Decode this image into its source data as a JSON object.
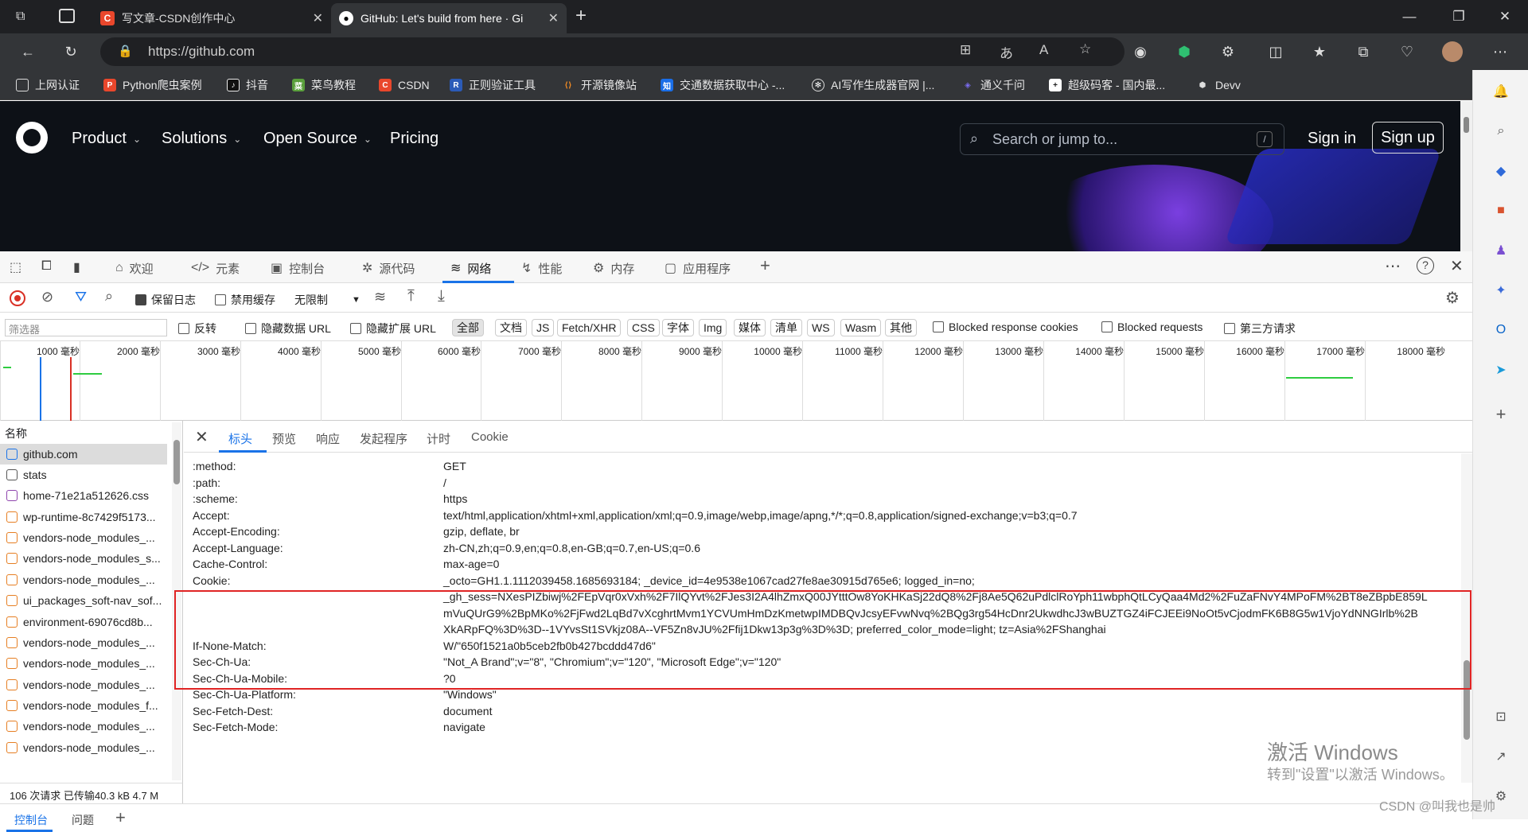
{
  "browser": {
    "tabs": [
      {
        "title": "写文章-CSDN创作中心",
        "icon": "csdn-icon"
      },
      {
        "title": "GitHub: Let's build from here · Gi",
        "icon": "github-icon"
      }
    ],
    "url": "https://github.com",
    "bookmarks": [
      "上网认证",
      "Python爬虫案例",
      "抖音",
      "菜鸟教程",
      "CSDN",
      "正则验证工具",
      "开源镜像站",
      "交通数据获取中心 -...",
      "AI写作生成器官网 |...",
      "通义千问",
      "超级码客 - 国内最...",
      "Devv"
    ]
  },
  "github": {
    "nav": [
      "Product",
      "Solutions",
      "Open Source",
      "Pricing"
    ],
    "search_placeholder": "Search or jump to...",
    "search_key": "/",
    "sign_in": "Sign in",
    "sign_up": "Sign up"
  },
  "devtools": {
    "tabs": [
      "欢迎",
      "元素",
      "控制台",
      "源代码",
      "网络",
      "性能",
      "内存",
      "应用程序"
    ],
    "preserve_log": "保留日志",
    "disable_cache": "禁用缓存",
    "throttle": "无限制",
    "filter_placeholder": "筛选器",
    "invert": "反转",
    "hide_data_url": "隐藏数据 URL",
    "hide_ext_url": "隐藏扩展 URL",
    "types": [
      "全部",
      "文档",
      "JS",
      "Fetch/XHR",
      "CSS",
      "字体",
      "Img",
      "媒体",
      "清单",
      "WS",
      "Wasm",
      "其他"
    ],
    "blocked_cookies": "Blocked response cookies",
    "blocked_requests": "Blocked requests",
    "third_party": "第三方请求",
    "ticks": [
      "1000 毫秒",
      "2000 毫秒",
      "3000 毫秒",
      "4000 毫秒",
      "5000 毫秒",
      "6000 毫秒",
      "7000 毫秒",
      "8000 毫秒",
      "9000 毫秒",
      "10000 毫秒",
      "11000 毫秒",
      "12000 毫秒",
      "13000 毫秒",
      "14000 毫秒",
      "15000 毫秒",
      "16000 毫秒",
      "17000 毫秒",
      "18000 毫秒"
    ],
    "name_header": "名称",
    "requests": [
      "github.com",
      "stats",
      "home-71e21a512626.css",
      "wp-runtime-8c7429f5173...",
      "vendors-node_modules_...",
      "vendors-node_modules_s...",
      "vendors-node_modules_...",
      "ui_packages_soft-nav_sof...",
      "environment-69076cd8b...",
      "vendors-node_modules_...",
      "vendors-node_modules_...",
      "vendors-node_modules_...",
      "vendors-node_modules_f...",
      "vendors-node_modules_...",
      "vendors-node_modules_..."
    ],
    "detail_tabs": [
      "标头",
      "预览",
      "响应",
      "发起程序",
      "计时",
      "Cookie"
    ],
    "headers": [
      {
        "k": ":method:",
        "v": "GET"
      },
      {
        "k": ":path:",
        "v": "/"
      },
      {
        "k": ":scheme:",
        "v": "https"
      },
      {
        "k": "Accept:",
        "v": "text/html,application/xhtml+xml,application/xml;q=0.9,image/webp,image/apng,*/*;q=0.8,application/signed-exchange;v=b3;q=0.7"
      },
      {
        "k": "Accept-Encoding:",
        "v": "gzip, deflate, br"
      },
      {
        "k": "Accept-Language:",
        "v": "zh-CN,zh;q=0.9,en;q=0.8,en-GB;q=0.7,en-US;q=0.6"
      },
      {
        "k": "Cache-Control:",
        "v": "max-age=0"
      }
    ],
    "cookie_key": "Cookie:",
    "cookie_lines": [
      "_octo=GH1.1.1112039458.1685693184; _device_id=4e9538e1067cad27fe8ae30915d765e6; logged_in=no;",
      "_gh_sess=NXesPIZbiwj%2FEpVqr0xVxh%2F7IlQYvt%2FJes3I2A4lhZmxQ00JYtttOw8YoKHKaSj22dQ8%2Fj8Ae5Q62uPdlclRoYph11wbphQtLCyQaa4Md2%2FuZaFNvY4MPoFM%2BT8eZBpbE859L",
      "mVuQUrG9%2BpMKo%2FjFwd2LqBd7vXcghrtMvm1YCVUmHmDzKmetwpIMDBQvJcsyEFvwNvq%2BQg3rg54HcDnr2UkwdhcJ3wBUZTGZ4iFCJEEi9NoOt5vCjodmFK6B8G5w1VjoYdNNGIrlb%2B",
      "XkARpFQ%3D%3D--1VYvsSt1SVkjz08A--VF5Zn8vJU%2Ffij1Dkw13p3g%3D%3D; preferred_color_mode=light; tz=Asia%2FShanghai"
    ],
    "headers2": [
      {
        "k": "If-None-Match:",
        "v": "W/\"650f1521a0b5ceb2fb0b427bcddd47d6\""
      },
      {
        "k": "Sec-Ch-Ua:",
        "v": "\"Not_A Brand\";v=\"8\", \"Chromium\";v=\"120\", \"Microsoft Edge\";v=\"120\""
      },
      {
        "k": "Sec-Ch-Ua-Mobile:",
        "v": "?0"
      },
      {
        "k": "Sec-Ch-Ua-Platform:",
        "v": "\"Windows\""
      },
      {
        "k": "Sec-Fetch-Dest:",
        "v": "document"
      },
      {
        "k": "Sec-Fetch-Mode:",
        "v": "navigate"
      }
    ],
    "status": "106 次请求   已传输40.3 kB   4.7 M",
    "drawer_tabs": [
      "控制台",
      "问题"
    ]
  },
  "overlay": {
    "watermark_title": "激活 Windows",
    "watermark_sub": "转到\"设置\"以激活 Windows。",
    "csdn_mark": "CSDN @叫我也是帅"
  }
}
